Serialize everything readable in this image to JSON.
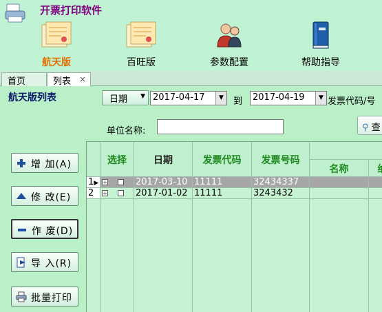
{
  "app": {
    "title": "开票打印软件"
  },
  "modules": [
    {
      "label": "航天版",
      "active": true,
      "icon": "invoice-doc-icon"
    },
    {
      "label": "百旺版",
      "active": false,
      "icon": "invoice-doc-icon"
    },
    {
      "label": "参数配置",
      "active": false,
      "icon": "users-config-icon"
    },
    {
      "label": "帮助指导",
      "active": false,
      "icon": "help-book-icon"
    }
  ],
  "tabs": [
    {
      "label": "首页"
    },
    {
      "label": "列表",
      "close": "×"
    }
  ],
  "filter": {
    "section_title": "航天版列表",
    "date_type": "日期",
    "date_from": "2017-04-17",
    "to_label": "到",
    "date_to": "2017-04-19",
    "code_label": "发票代码/号",
    "unit_label": "单位名称:",
    "unit_value": "",
    "query_label": "查"
  },
  "actions": {
    "add": "增 加(A)",
    "edit": "修 改(E)",
    "void": "作 废(D)",
    "import": "导 入(R)",
    "batch_print": "批量打印"
  },
  "grid": {
    "columns": [
      "选择",
      "日期",
      "发票代码",
      "发票号码"
    ],
    "sub_columns": [
      "名称",
      "纳"
    ],
    "rows": [
      {
        "num": "1",
        "date": "2017-03-10",
        "code": "11111",
        "number": "32434337",
        "selected": true
      },
      {
        "num": "2",
        "date": "2017-01-02",
        "code": "11111",
        "number": "3243432",
        "selected": false
      }
    ]
  },
  "colors": {
    "accent": "#e07000",
    "title": "#800080",
    "header_text": "#1e8a1e",
    "background": "#b9f0c8"
  }
}
